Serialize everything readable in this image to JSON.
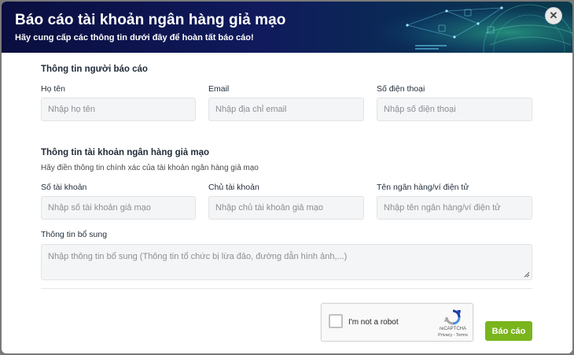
{
  "header": {
    "title": "Báo cáo tài khoản ngân hàng giả mạo",
    "subtitle": "Hãy cung cấp các thông tin dưới đây để hoàn tất báo cáo!",
    "close_icon": "close-icon"
  },
  "reporter": {
    "section_title": "Thông tin người báo cáo",
    "name_label": "Họ tên",
    "name_placeholder": "Nhập họ tên",
    "email_label": "Email",
    "email_placeholder": "Nhập địa chỉ email",
    "phone_label": "Số điện thoại",
    "phone_placeholder": "Nhập số điện thoại"
  },
  "account": {
    "section_title": "Thông tin tài khoản ngân hàng giả mạo",
    "hint": "Hãy điền thông tin chính xác của tài khoản ngân hàng giả mạo",
    "number_label": "Số tài khoản",
    "number_placeholder": "Nhập số tài khoản giả mạo",
    "owner_label": "Chủ tài khoản",
    "owner_placeholder": "Nhập chủ tài khoản giả mạo",
    "bank_label": "Tên ngân hàng/ví điện tử",
    "bank_placeholder": "Nhập tên ngân hàng/ví điện tử"
  },
  "extra": {
    "label": "Thông tin bổ sung",
    "placeholder": "Nhập thông tin bổ sung (Thông tin tổ chức bị lừa đảo, đường dẫn hình ảnh,...)"
  },
  "recaptcha": {
    "label": "I'm not a robot",
    "brand": "reCAPTCHA",
    "terms": "Privacy - Terms"
  },
  "submit_label": "Báo cáo",
  "colors": {
    "header_bg": "#0a0e3f",
    "submit_bg": "#7ab51d"
  }
}
